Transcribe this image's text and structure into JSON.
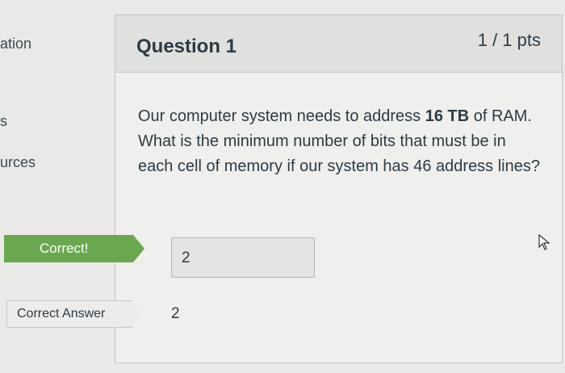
{
  "sidebar": {
    "items": [
      {
        "label": "ation"
      },
      {
        "label": "s"
      },
      {
        "label": "urces"
      }
    ]
  },
  "question": {
    "title": "Question 1",
    "points": "1 / 1 pts",
    "text_before": "Our computer system needs to address ",
    "text_bold": "16 TB",
    "text_after": " of RAM. What is the minimum number of bits that must be in each cell of memory if our system has 46 address lines?"
  },
  "result": {
    "correct_label": "Correct!",
    "user_answer": "2",
    "correct_answer_label": "Correct Answer",
    "correct_answer_value": "2"
  },
  "colors": {
    "correct_green": "#6aa84f",
    "text": "#2d3b45",
    "header_bg": "#e0e1df"
  },
  "icons": {
    "cursor": "mouse-pointer-icon"
  }
}
